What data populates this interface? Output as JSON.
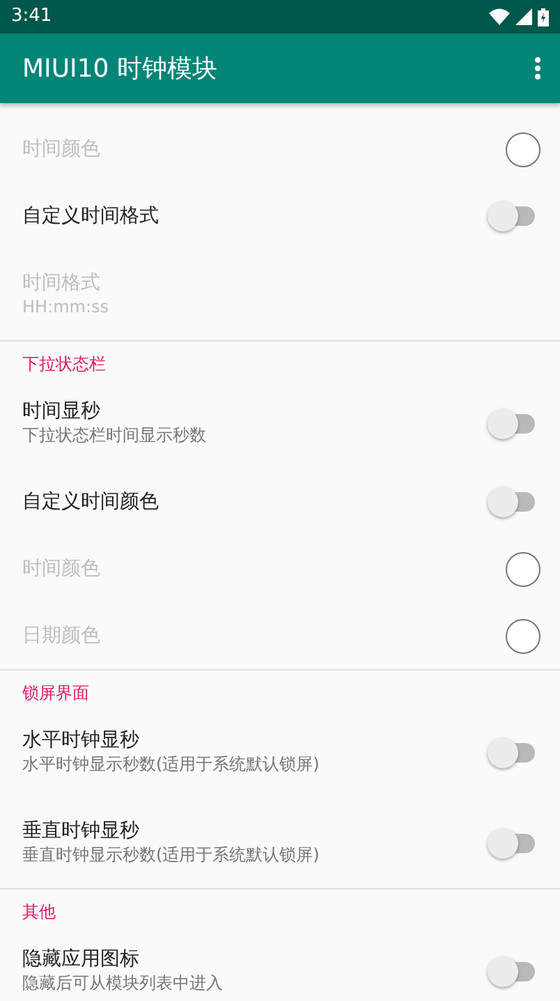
{
  "status_bar": {
    "time": "3:41"
  },
  "app_bar": {
    "title": "MIUI10 时钟模块"
  },
  "sections": [
    {
      "items": [
        {
          "kind": "color",
          "title": "时间颜色",
          "disabled": true
        },
        {
          "kind": "switch",
          "title": "自定义时间格式",
          "disabled": false,
          "on": false
        },
        {
          "kind": "text",
          "title": "时间格式",
          "summary": "HH:mm:ss",
          "disabled": true
        }
      ]
    },
    {
      "header": "下拉状态栏",
      "items": [
        {
          "kind": "switch",
          "title": "时间显秒",
          "summary": "下拉状态栏时间显示秒数",
          "disabled": false,
          "on": false
        },
        {
          "kind": "switch",
          "title": "自定义时间颜色",
          "disabled": false,
          "on": false
        },
        {
          "kind": "color",
          "title": "时间颜色",
          "disabled": true
        },
        {
          "kind": "color",
          "title": "日期颜色",
          "disabled": true
        }
      ]
    },
    {
      "header": "锁屏界面",
      "items": [
        {
          "kind": "switch",
          "title": "水平时钟显秒",
          "summary": "水平时钟显示秒数(适用于系统默认锁屏)",
          "disabled": false,
          "on": false
        },
        {
          "kind": "switch",
          "title": "垂直时钟显秒",
          "summary": "垂直时钟显示秒数(适用于系统默认锁屏)",
          "disabled": false,
          "on": false
        }
      ]
    },
    {
      "header": "其他",
      "items": [
        {
          "kind": "switch",
          "title": "隐藏应用图标",
          "summary": "隐藏后可从模块列表中进入",
          "disabled": false,
          "on": false
        }
      ]
    }
  ]
}
